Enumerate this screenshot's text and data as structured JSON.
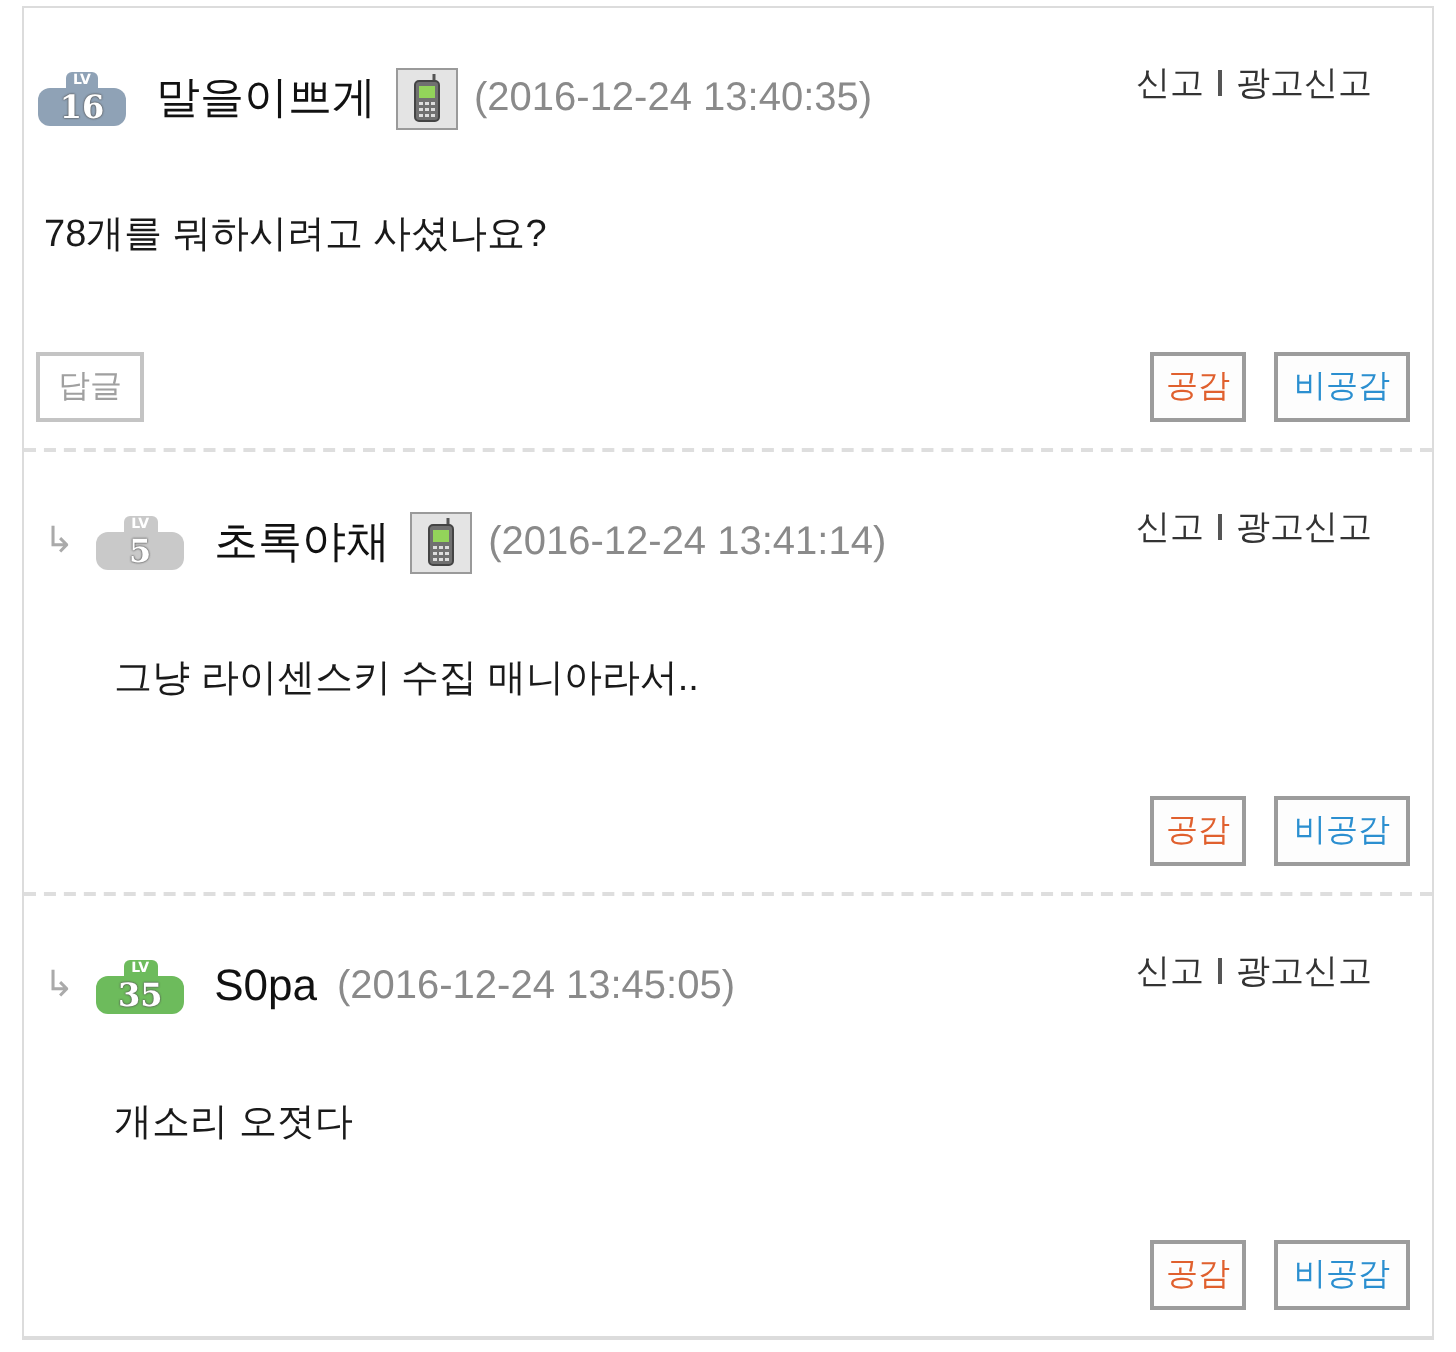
{
  "comments": [
    {
      "kind": "comment",
      "badge": {
        "label": "LV",
        "number": "16",
        "color": "#8fa2b6"
      },
      "author": "말을이쁘게",
      "mobile": true,
      "timestamp": "(2016-12-24 13:40:35)",
      "report_links": [
        "신고",
        "광고신고"
      ],
      "text": "78개를 뭐하시려고 사셨나요?",
      "reply_button": "답글",
      "vote_buttons": [
        {
          "kind": "like",
          "label": "공감"
        },
        {
          "kind": "dislike",
          "label": "비공감"
        }
      ]
    },
    {
      "kind": "reply",
      "arrow": "↳",
      "badge": {
        "label": "LV",
        "number": "5",
        "color": "#c9c9c9"
      },
      "author": "초록야채",
      "mobile": true,
      "timestamp": "(2016-12-24 13:41:14)",
      "report_links": [
        "신고",
        "광고신고"
      ],
      "text": "그냥 라이센스키 수집 매니아라서..",
      "vote_buttons": [
        {
          "kind": "like",
          "label": "공감"
        },
        {
          "kind": "dislike",
          "label": "비공감"
        }
      ]
    },
    {
      "kind": "reply",
      "arrow": "↳",
      "badge": {
        "label": "LV",
        "number": "35",
        "color": "#6dbb5c"
      },
      "author": "S0pa",
      "mobile": false,
      "timestamp": "(2016-12-24 13:45:05)",
      "report_links": [
        "신고",
        "광고신고"
      ],
      "text": "개소리 오졋다",
      "vote_buttons": [
        {
          "kind": "like",
          "label": "공감"
        },
        {
          "kind": "dislike",
          "label": "비공감"
        }
      ]
    }
  ]
}
